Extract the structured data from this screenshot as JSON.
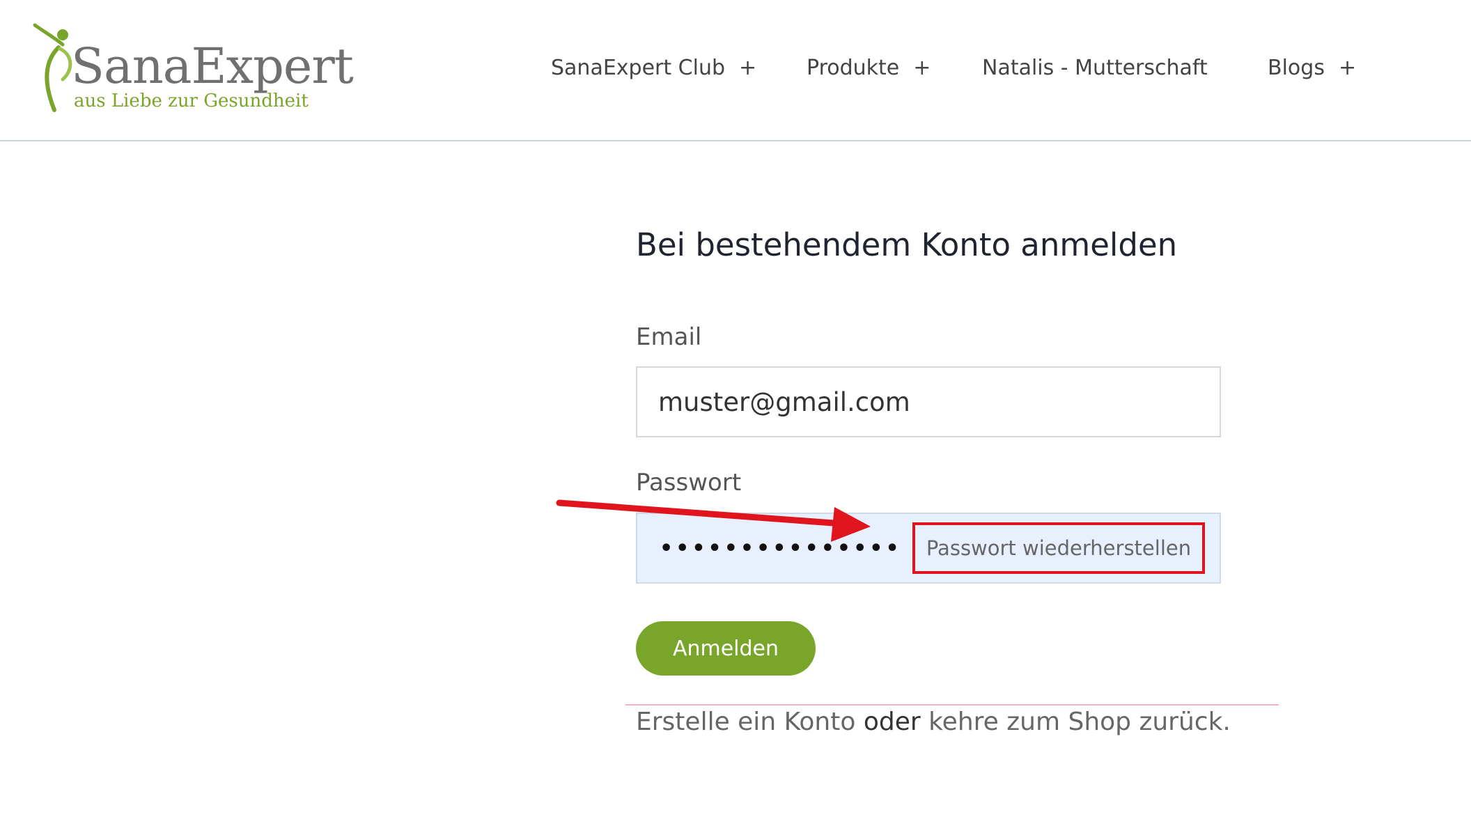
{
  "brand": {
    "name": "SanaExpert",
    "tagline": "aus Liebe zur Gesundheit",
    "colors": {
      "green": "#7aa52b",
      "grey": "#707070"
    }
  },
  "nav": {
    "items": [
      {
        "label": "SanaExpert Club",
        "plus": "+"
      },
      {
        "label": "Produkte",
        "plus": "+"
      },
      {
        "label": "Natalis - Mutterschaft",
        "plus": ""
      },
      {
        "label": "Blogs",
        "plus": "+"
      }
    ]
  },
  "login": {
    "title": "Bei bestehendem Konto anmelden",
    "email_label": "Email",
    "email_value": "muster@gmail.com",
    "password_label": "Passwort",
    "password_masked": "•••••••••••••••",
    "recover_link": "Passwort wiederherstellen",
    "submit_label": "Anmelden"
  },
  "footer": {
    "create_account": "Erstelle ein Konto",
    "or": "oder",
    "return_shop": "kehre zum Shop zurück."
  },
  "annotation": {
    "arrow_color": "#e0141c",
    "highlight_color": "#e0141c"
  }
}
